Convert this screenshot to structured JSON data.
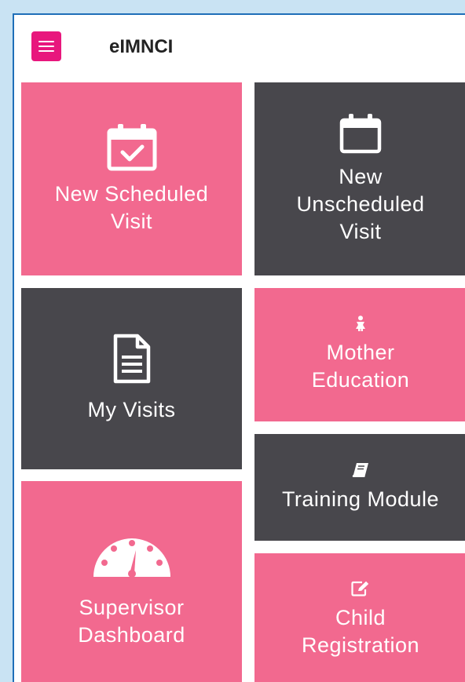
{
  "app": {
    "title": "eIMNCI"
  },
  "tiles": {
    "new_scheduled_visit": {
      "label": "New Scheduled\nVisit",
      "icon": "calendar-check-icon"
    },
    "new_unscheduled_visit": {
      "label": "New\nUnscheduled\nVisit",
      "icon": "calendar-icon"
    },
    "my_visits": {
      "label": "My Visits",
      "icon": "document-icon"
    },
    "mother_education": {
      "label": "Mother\nEducation",
      "icon": "mother-icon"
    },
    "training_module": {
      "label": "Training Module",
      "icon": "book-icon"
    },
    "supervisor_dashboard": {
      "label": "Supervisor\nDashboard",
      "icon": "gauge-icon"
    },
    "child_registration": {
      "label": "Child\nRegistration",
      "icon": "edit-icon"
    }
  },
  "colors": {
    "pink_tile": "#f2698f",
    "dark_tile": "#48474c",
    "menu_button": "#e8177d",
    "background": "#c9e3f3"
  }
}
